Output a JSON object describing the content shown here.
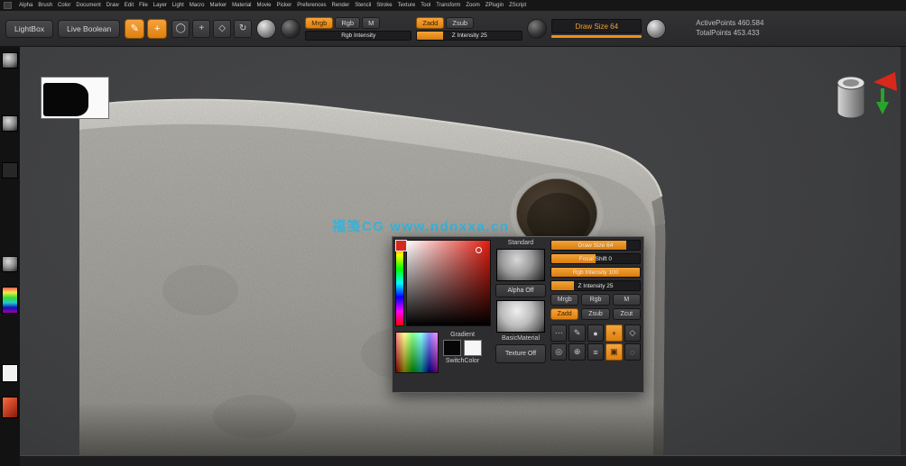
{
  "menubar": {
    "items": [
      "Alpha",
      "Brush",
      "Color",
      "Document",
      "Draw",
      "Edit",
      "File",
      "Layer",
      "Light",
      "Macro",
      "Marker",
      "Material",
      "Movie",
      "Picker",
      "Preferences",
      "Render",
      "Stencil",
      "Stroke",
      "Texture",
      "Tool",
      "Transform",
      "Zoom",
      "ZPlugin",
      "ZScript"
    ]
  },
  "toolbar": {
    "lightbox_label": "LightBox",
    "live_boolean_label": "Live Boolean",
    "tool_icons": [
      {
        "name": "current-brush-icon",
        "glyph": "✎"
      },
      {
        "name": "gradient-swatch-icon",
        "glyph": "+"
      }
    ],
    "mode_icons": [
      {
        "name": "draw-pointer-icon",
        "glyph": "◯"
      },
      {
        "name": "move-icon",
        "glyph": "+"
      },
      {
        "name": "scale-icon",
        "glyph": "◇"
      },
      {
        "name": "rotate-icon",
        "glyph": "↻"
      }
    ],
    "mrgb_label": "Mrgb",
    "rgb_label": "Rgb",
    "m_label": "M",
    "rgb_intensity_label": "Rgb Intensity",
    "zadd_label": "Zadd",
    "zsub_label": "Zsub",
    "z_intensity_label": "Z Intensity 25",
    "draw_size_label": "Draw Size 64",
    "stats": {
      "line1": "ActivePoints 460.584",
      "line2": "TotalPoints 453.433"
    }
  },
  "tray": {
    "items": [
      {
        "name": "material-sphere-thumb-1",
        "kind": "ball"
      },
      {
        "name": "material-sphere-thumb-2",
        "kind": "ball"
      },
      {
        "name": "texture-slot-thumb",
        "kind": "slot"
      },
      {
        "name": "material-sphere-thumb-3",
        "kind": "ball"
      },
      {
        "name": "color-spectrum-thumb",
        "kind": "spectrum"
      },
      {
        "name": "main-color-swatch",
        "kind": "white"
      },
      {
        "name": "secondary-color-swatch",
        "kind": "red"
      }
    ]
  },
  "canvas": {
    "watermark": "福笺CG  www.ndnxxa.cn"
  },
  "popup": {
    "gradient_label": "Gradient",
    "switch_color_label": "SwitchColor",
    "brush_name": "Standard",
    "alpha_label": "Alpha Off",
    "material_name": "BasicMaterial",
    "texture_label": "Texture Off",
    "sliders": [
      {
        "name": "draw-size-slider",
        "label": "Draw Size 64",
        "fill": 85
      },
      {
        "name": "focal-shift-slider",
        "label": "Focal Shift 0",
        "fill": 50
      },
      {
        "name": "rgb-intensity-slider",
        "label": "Rgb Intensity 100",
        "fill": 100
      },
      {
        "name": "z-intensity-slider",
        "label": "Z Intensity 25",
        "fill": 25
      }
    ],
    "mode_buttons": [
      {
        "name": "mrgb-button",
        "label": "Mrgb",
        "active": false
      },
      {
        "name": "rgb-button",
        "label": "Rgb",
        "active": false
      },
      {
        "name": "m-button",
        "label": "M",
        "active": false
      }
    ],
    "sculpt_buttons": [
      {
        "name": "zadd-button",
        "label": "Zadd",
        "active": true
      },
      {
        "name": "zsub-button",
        "label": "Zsub",
        "active": false
      },
      {
        "name": "zcut-button",
        "label": "Zcut",
        "active": false
      }
    ],
    "grid": [
      {
        "name": "stroke-dots-icon",
        "glyph": "⋯",
        "active": false
      },
      {
        "name": "edit-icon",
        "glyph": "✎",
        "active": false
      },
      {
        "name": "draw-icon",
        "glyph": "●",
        "active": false
      },
      {
        "name": "move-icon",
        "glyph": "+",
        "active": true
      },
      {
        "name": "scale-icon",
        "glyph": "◇",
        "active": false
      },
      {
        "name": "frame-icon",
        "glyph": "◎",
        "active": false
      },
      {
        "name": "zoom-icon",
        "glyph": "⊕",
        "active": false
      },
      {
        "name": "scroll-icon",
        "glyph": "≡",
        "active": false
      },
      {
        "name": "actual-size-icon",
        "glyph": "▣",
        "active": true
      },
      {
        "name": "aa-half-icon",
        "glyph": "◌",
        "active": false
      }
    ],
    "current_color": "#d42a1e"
  }
}
